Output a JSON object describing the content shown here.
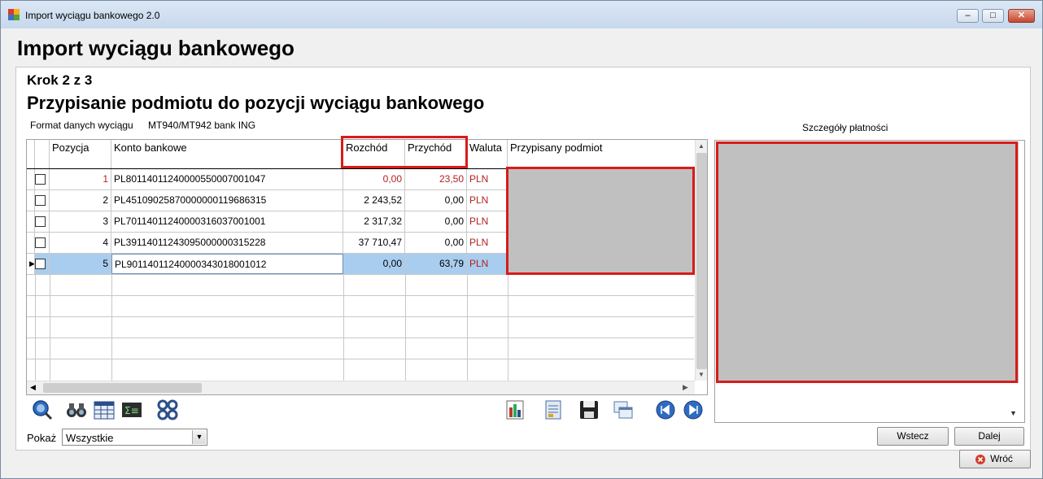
{
  "window": {
    "title": "Import wyciągu bankowego 2.0",
    "minimize": "–",
    "maximize": "□",
    "close": "✕"
  },
  "header": {
    "title": "Import wyciągu bankowego"
  },
  "wizard": {
    "step": "Krok 2 z 3",
    "subtitle": "Przypisanie podmiotu do pozycji wyciągu bankowego",
    "format_label": "Format danych wyciągu",
    "format_value": "MT940/MT942 bank ING"
  },
  "grid": {
    "columns": [
      "Pozycja",
      "Konto bankowe",
      "Rozchód",
      "Przychód",
      "Waluta",
      "Przypisany podmiot"
    ],
    "rows": [
      {
        "pozycja": "1",
        "konto": "PL80114011240000550007001047",
        "rozchod": "0,00",
        "przychod": "23,50",
        "waluta": "PLN"
      },
      {
        "pozycja": "2",
        "konto": "PL45109025870000000119686315",
        "rozchod": "2 243,52",
        "przychod": "0,00",
        "waluta": "PLN"
      },
      {
        "pozycja": "3",
        "konto": "PL70114011240000316037001001",
        "rozchod": "2 317,32",
        "przychod": "0,00",
        "waluta": "PLN"
      },
      {
        "pozycja": "4",
        "konto": "PL39114011243095000000315228",
        "rozchod": "37 710,47",
        "przychod": "0,00",
        "waluta": "PLN"
      },
      {
        "pozycja": "5",
        "konto": "PL90114011240000343018001012",
        "rozchod": "0,00",
        "przychod": "63,79",
        "waluta": "PLN"
      }
    ],
    "selected_row": 5,
    "row_indicator": "▶",
    "scroll_up": "▲",
    "scroll_down": "▼",
    "scroll_left": "◀",
    "scroll_right": "▶"
  },
  "details": {
    "label": "Szczegóły płatności"
  },
  "filter": {
    "label": "Pokaż",
    "value": "Wszystkie",
    "arrow": "▼"
  },
  "buttons": {
    "back": "Wstecz",
    "next": "Dalej",
    "return": "Wróć"
  },
  "colors": {
    "title_gradient": "#c7d8ec",
    "selection": "#a9cdee",
    "highlight_red": "#d81b1b",
    "redacted": "#c0c0c0"
  }
}
